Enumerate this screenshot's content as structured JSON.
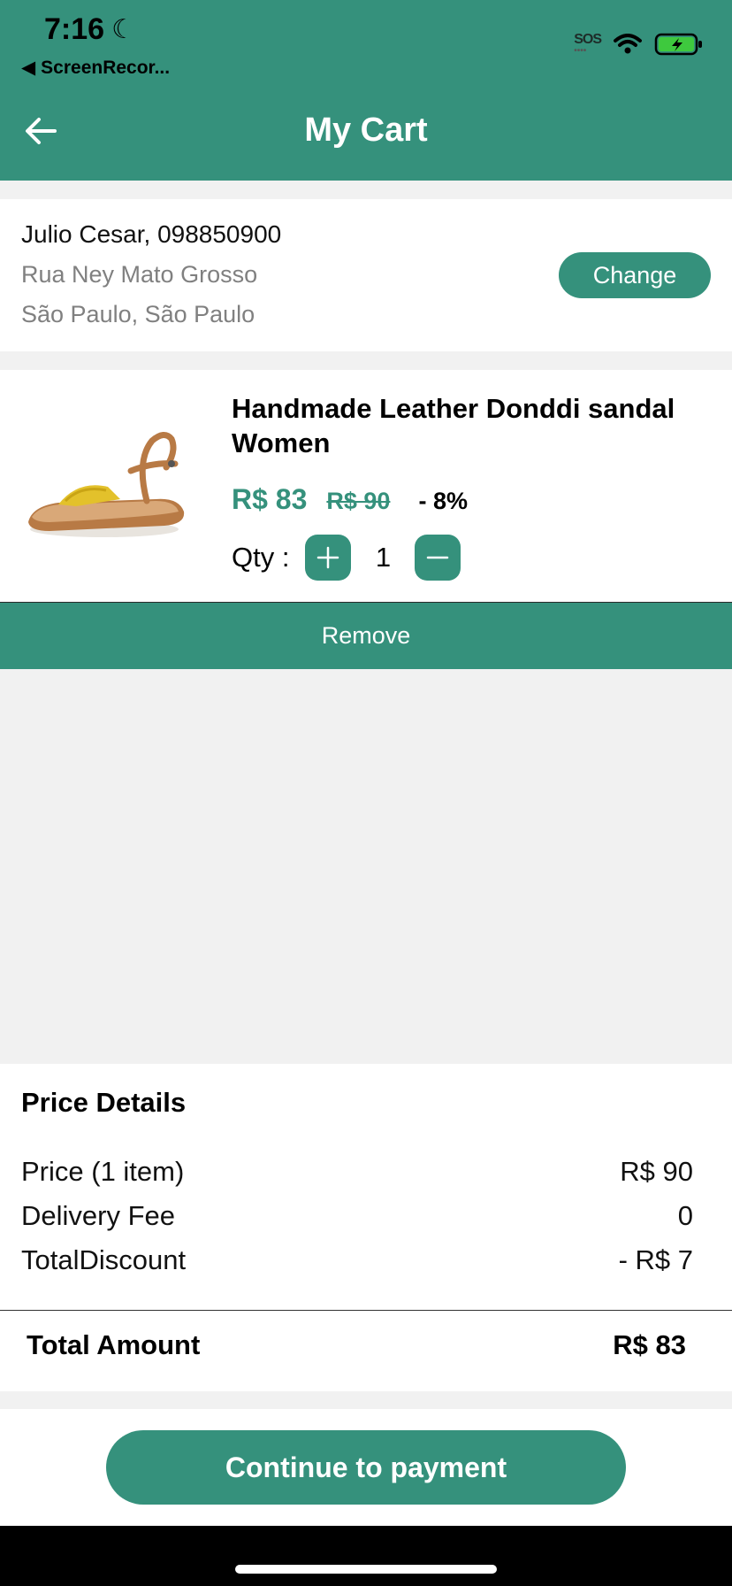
{
  "status": {
    "time": "7:16",
    "back_app": "ScreenRecor...",
    "sos": "SOS"
  },
  "header": {
    "title": "My Cart"
  },
  "address": {
    "name_phone": "Julio Cesar, 098850900",
    "street": "Rua Ney Mato Grosso",
    "city": "São Paulo, São Paulo",
    "change_label": "Change"
  },
  "item": {
    "title_line1": "Handmade Leather Donddi sandal",
    "title_line2": "Women",
    "price_now": "R$ 83",
    "price_old": "R$ 90",
    "discount": "- 8%",
    "qty_label": "Qty :",
    "qty_value": "1",
    "remove_label": "Remove"
  },
  "price_details": {
    "title": "Price Details",
    "rows": [
      {
        "label": "Price (1 item)",
        "value": "R$ 90"
      },
      {
        "label": "Delivery Fee",
        "value": "0"
      },
      {
        "label": "TotalDiscount",
        "value": "- R$ 7"
      }
    ],
    "total_label": "Total Amount",
    "total_value": "R$ 83"
  },
  "footer": {
    "pay_label": "Continue to payment"
  },
  "colors": {
    "accent": "#35917c",
    "background": "#f1f1f1"
  }
}
